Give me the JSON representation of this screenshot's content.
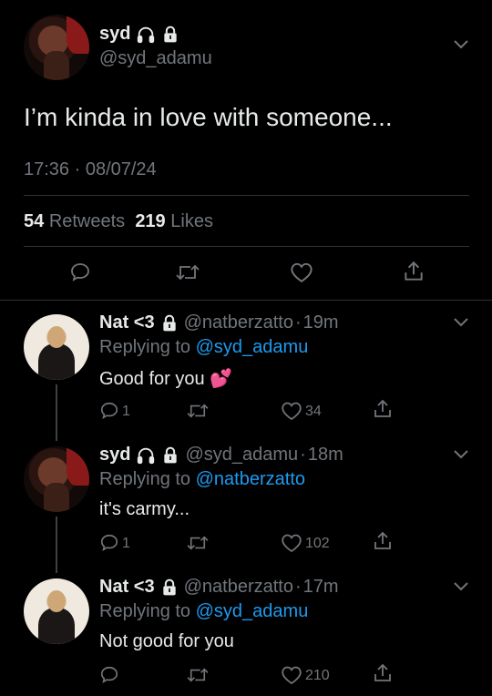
{
  "main": {
    "author": {
      "name": "syd",
      "handle": "@syd_adamu"
    },
    "text": "I’m kinda in love with someone...",
    "time": "17:36 · 08/07/24",
    "retweets": {
      "count": "54",
      "label": "Retweets"
    },
    "likes": {
      "count": "219",
      "label": "Likes"
    }
  },
  "replies": [
    {
      "name": "Nat <3",
      "handle": "@natberzatto",
      "time": "19m",
      "replying_label": "Replying to",
      "replying_to": "@syd_adamu",
      "text": "Good for you 💕",
      "reply_count": "1",
      "like_count": "34"
    },
    {
      "name": "syd",
      "handle": "@syd_adamu",
      "time": "18m",
      "replying_label": "Replying to",
      "replying_to": "@natberzatto",
      "text": "it's carmy...",
      "reply_count": "1",
      "like_count": "102"
    },
    {
      "name": "Nat <3",
      "handle": "@natberzatto",
      "time": "17m",
      "replying_label": "Replying to",
      "replying_to": "@syd_adamu",
      "text": "Not good for you",
      "reply_count": "",
      "like_count": "210"
    }
  ],
  "dot": "·",
  "icons": {
    "headphones": "headphones-icon",
    "lock": "lock-icon",
    "chevron": "chevron-down-icon",
    "reply": "reply-icon",
    "retweet": "retweet-icon",
    "like": "heart-icon",
    "share": "share-icon"
  }
}
